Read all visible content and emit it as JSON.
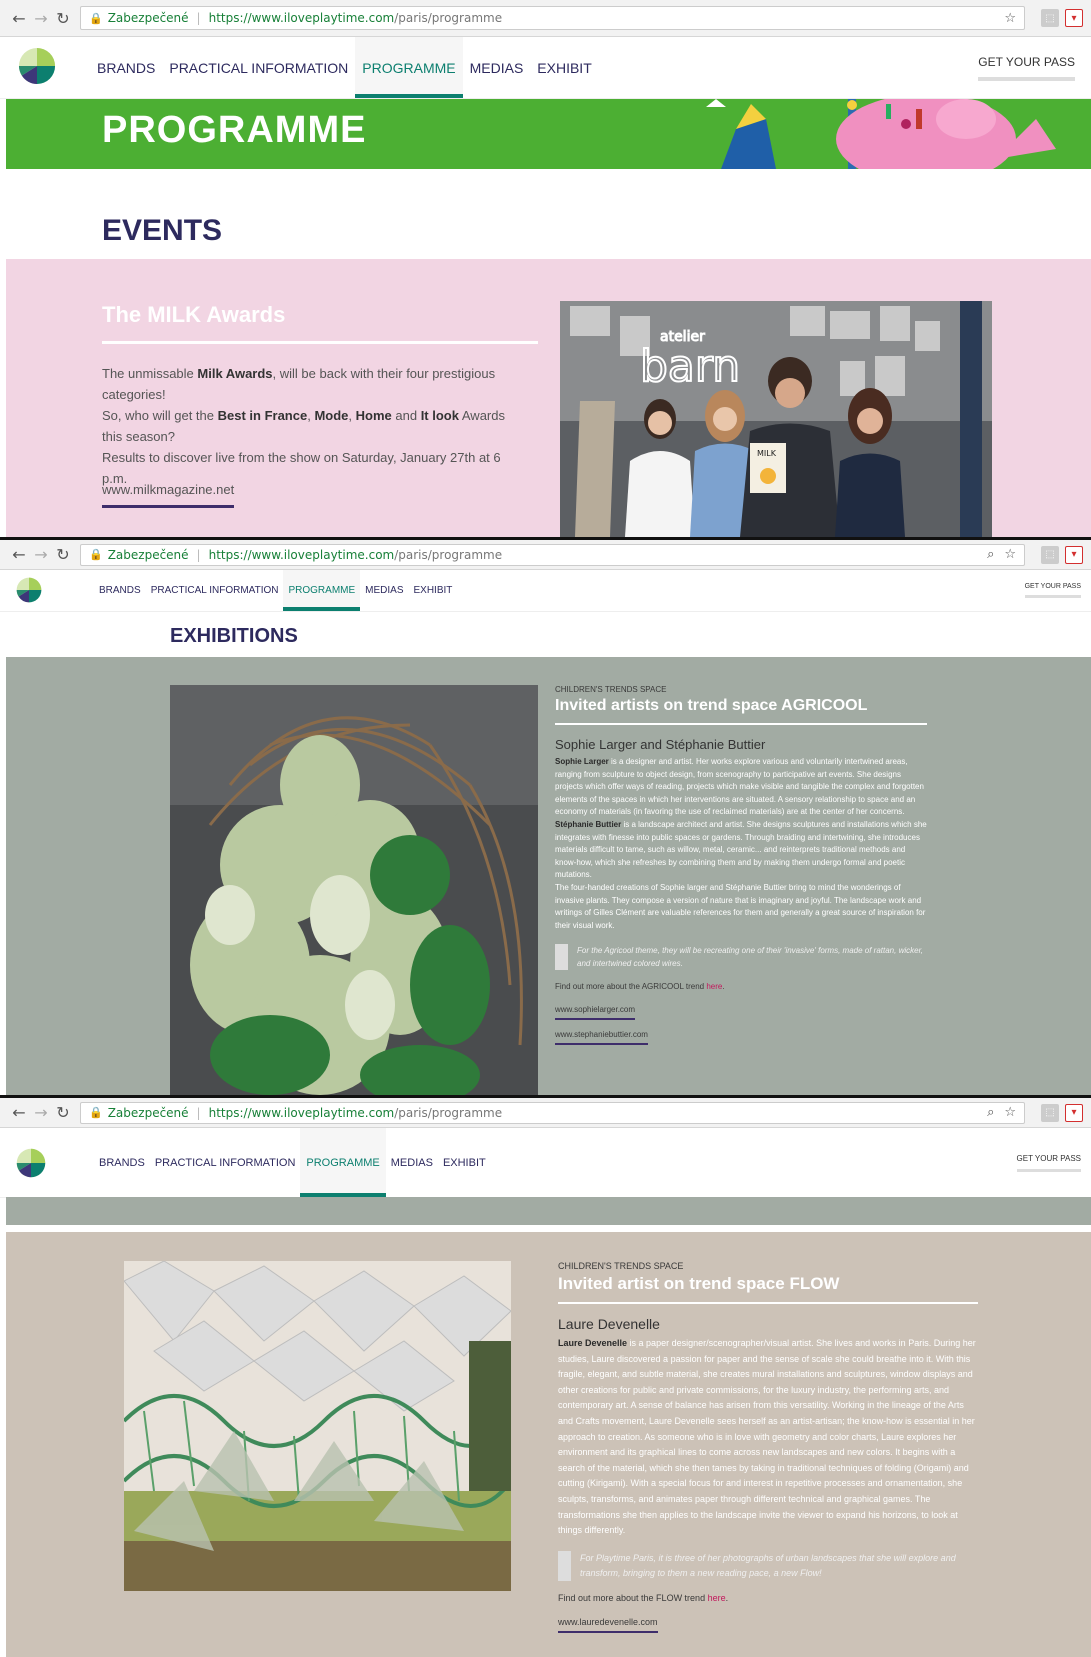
{
  "browser": {
    "secure_label": "Zabezpečené",
    "separator": "|",
    "url_host": "https://www.iloveplaytime.com",
    "url_path": "/paris/programme"
  },
  "site_nav": {
    "items": [
      "BRANDS",
      "PRACTICAL INFORMATION",
      "PROGRAMME",
      "MEDIAS",
      "EXHIBIT"
    ],
    "active": "PROGRAMME",
    "cta": "GET YOUR PASS"
  },
  "programme_banner": {
    "title": "PROGRAMME",
    "color": "#4caf33"
  },
  "events": {
    "heading": "EVENTS",
    "milk": {
      "title": "The MILK Awards",
      "p1_pre": "The unmissable ",
      "p1_bold": "Milk Awards",
      "p1_post": ", will be back with their four prestigious categories!",
      "p2_pre": "So, who will get the ",
      "award1": "Best in France",
      "award2": "Mode",
      "award3": "Home",
      "p2_and": " and ",
      "award4": "It look",
      "p2_post": " Awards this season?",
      "p3": "Results to discover live from the show on Saturday, January 27th at 6 p.m.",
      "link": "www.milkmagazine.net",
      "photo_sign_1": "atelier",
      "photo_sign_2": "barn",
      "photo_book": "MILK"
    }
  },
  "exhibitions": {
    "heading": "EXHIBITIONS",
    "agricool": {
      "kicker": "CHILDREN'S TRENDS SPACE",
      "title": "Invited artists on trend space AGRICOOL",
      "artists": "Sophie Larger and Stéphanie Buttier",
      "p1_bold": "Sophie Larger",
      "p1": " is a designer and artist. Her works explore various and voluntarily intertwined areas, ranging from sculpture to object design, from scenography to participative art events. She designs projects which offer ways of reading, projects which make visible and tangible the complex and forgotten elements of the spaces in which her interventions are situated. A sensory relationship to space and an economy of materials (in favoring the use of reclaimed materials) are at the center of her concerns.",
      "p2_bold": "Stéphanie Buttier",
      "p2": " is a landscape architect and artist. She designs sculptures and installations which she integrates with finesse into public spaces or gardens. Through braiding and intertwining, she introduces materials difficult to tame, such as willow, metal, ceramic... and reinterprets traditional methods and know-how, which she refreshes by combining them and by making them undergo formal and poetic mutations.",
      "p3": "The four-handed creations of Sophie larger and Stéphanie Buttier bring to mind the wonderings of invasive plants. They compose a version of nature that is imaginary and joyful. The landscape work and writings of Gilles Clément are valuable references for them and generally a great source of inspiration for their visual work.",
      "quote": "For the Agricool theme, they will be recreating one of their 'invasive' forms, made of rattan, wicker, and intertwined colored wires.",
      "findout": "Find out more about the AGRICOOL trend ",
      "here": "here",
      "link1": "www.sophielarger.com",
      "link2": "www.stephaniebuttier.com"
    },
    "flow": {
      "kicker": "CHILDREN'S TRENDS SPACE",
      "title": "Invited artist on trend space FLOW",
      "artist": "Laure Devenelle",
      "p_bold": "Laure Devenelle",
      "p": " is a paper designer/scenographer/visual artist. She lives and works in Paris. During her studies, Laure discovered a passion for paper and the sense of scale she could breathe into it. With this fragile, elegant, and subtle material, she creates mural installations and sculptures, window displays and other creations for public and private commissions, for the luxury industry, the performing arts, and contemporary art. A sense of balance has arisen from this versatility. Working in the lineage of the Arts and Crafts movement, Laure Devenelle sees herself as an artist-artisan; the know-how is essential in her approach to creation. As someone who is in love with geometry and color charts, Laure explores her environment and its graphical lines to come across new landscapes and new colors. It begins with a search of the material, which she then tames by taking in traditional techniques of folding (Origami) and cutting (Kirigami). With a special focus for and interest in repetitive processes and ornamentation, she sculpts, transforms, and animates paper through different technical and graphical games. The transformations she then applies to the landscape invite the viewer to expand his horizons, to look at things differently.",
      "quote": "For Playtime Paris, it is three of her photographs of urban landscapes that she will explore and transform, bringing to them a new reading pace, a new Flow!",
      "findout": "Find out more about the FLOW trend ",
      "here": "here",
      "link": "www.lauredevenelle.com"
    }
  },
  "colors": {
    "nav_text": "#2d2a5e",
    "nav_active": "#0c7f6f",
    "milk_bg": "#f2d5e3",
    "agricool_bg": "#a2aba3",
    "flow_bg": "#ccc2b7",
    "link_accent": "#c2185b"
  }
}
